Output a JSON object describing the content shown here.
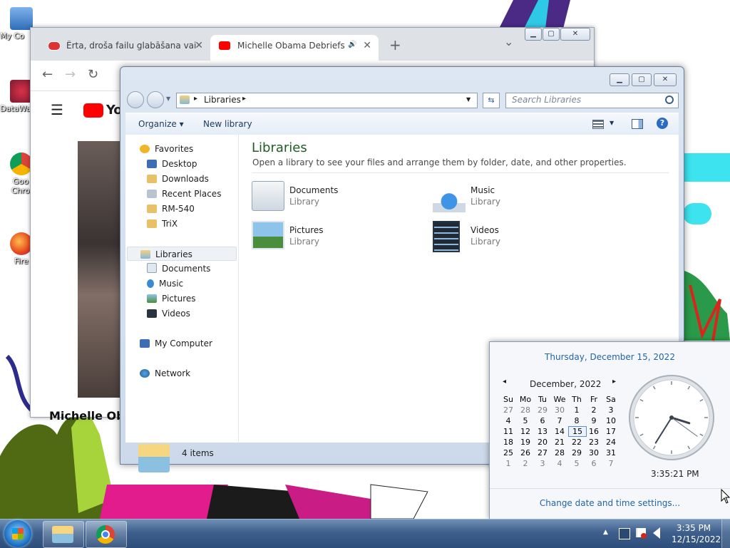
{
  "desktop": {
    "icons": [
      {
        "label": "My Co",
        "icon": "computer-icon"
      },
      {
        "label": "DataWa",
        "icon": "datawarehouse-icon"
      },
      {
        "label": "Goo",
        "label2": "Chro",
        "icon": "chrome-shortcut-icon"
      },
      {
        "label": "Fire",
        "icon": "firefox-shortcut-icon"
      }
    ]
  },
  "browser": {
    "tabs": [
      {
        "title": "Ērta, droša failu glabāšana vai ap",
        "icon": "cloud-favicon-icon",
        "close": "✕"
      },
      {
        "title": "Michelle Obama Debriefs Pe",
        "icon": "youtube-favicon-icon",
        "audio": "🔊",
        "close": "✕"
      }
    ],
    "new_tab": "+",
    "tab_menu": "⌄",
    "back": "←",
    "forward": "→",
    "reload": "↻",
    "menu": "☰",
    "youtube_logo": "Yo",
    "video_caption": "Michelle Ob"
  },
  "explorer": {
    "address": {
      "crumb": "Libraries",
      "sep": "▸"
    },
    "search": {
      "placeholder": "Search Libraries"
    },
    "toolbar": {
      "organize": "Organize",
      "organize_arrow": "▾",
      "new_library": "New library",
      "help": "?"
    },
    "nav": {
      "favorites": {
        "label": "Favorites",
        "items": [
          "Desktop",
          "Downloads",
          "Recent Places",
          "RM-540",
          "TriX"
        ]
      },
      "libraries": {
        "label": "Libraries",
        "items": [
          "Documents",
          "Music",
          "Pictures",
          "Videos"
        ]
      },
      "computer": "My Computer",
      "network": "Network"
    },
    "content": {
      "title": "Libraries",
      "subtitle": "Open a library to see your files and arrange them by folder, date, and other properties.",
      "items": [
        {
          "name": "Documents",
          "type": "Library"
        },
        {
          "name": "Music",
          "type": "Library"
        },
        {
          "name": "Pictures",
          "type": "Library"
        },
        {
          "name": "Videos",
          "type": "Library"
        }
      ]
    },
    "status": {
      "count": "4 items"
    }
  },
  "flyout": {
    "date_long": "Thursday, December 15, 2022",
    "month": "December, 2022",
    "prev": "◂",
    "next": "▸",
    "weekdays": [
      "Su",
      "Mo",
      "Tu",
      "We",
      "Th",
      "Fr",
      "Sa"
    ],
    "weeks": [
      [
        "27",
        "28",
        "29",
        "30",
        "1",
        "2",
        "3"
      ],
      [
        "4",
        "5",
        "6",
        "7",
        "8",
        "9",
        "10"
      ],
      [
        "11",
        "12",
        "13",
        "14",
        "15",
        "16",
        "17"
      ],
      [
        "18",
        "19",
        "20",
        "21",
        "22",
        "23",
        "24"
      ],
      [
        "25",
        "26",
        "27",
        "28",
        "29",
        "30",
        "31"
      ],
      [
        "1",
        "2",
        "3",
        "4",
        "5",
        "6",
        "7"
      ]
    ],
    "selected_day": "15",
    "time": "3:35:21 PM",
    "clock": {
      "hour": 3,
      "minute": 35,
      "second": 21
    },
    "change_link": "Change date and time settings..."
  },
  "taskbar": {
    "show_hidden": "▲",
    "time": "3:35 PM",
    "date": "12/15/2022"
  },
  "colors": {
    "accent": "#1f65a8",
    "libraries_title": "#1e5d24"
  }
}
